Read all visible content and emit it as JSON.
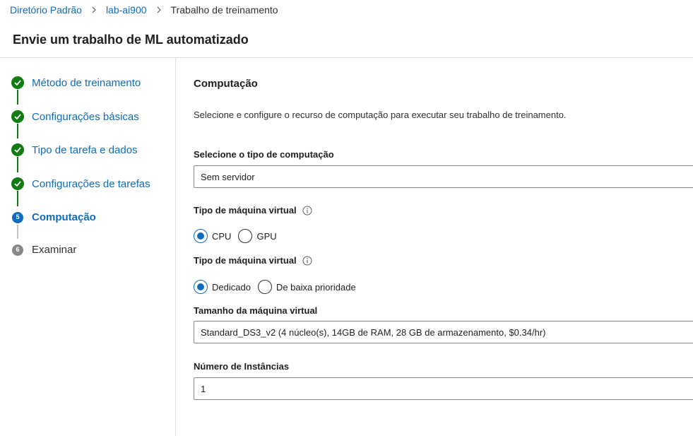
{
  "breadcrumb": {
    "items": [
      "Diretório Padrão",
      "lab-ai900"
    ],
    "current": "Trabalho de treinamento"
  },
  "page_title": "Envie um trabalho de ML automatizado",
  "steps": [
    {
      "label": "Método de treinamento",
      "status": "done"
    },
    {
      "label": "Configurações básicas",
      "status": "done"
    },
    {
      "label": "Tipo de tarefa e dados",
      "status": "done"
    },
    {
      "label": "Configurações de tarefas",
      "status": "done"
    },
    {
      "label": "Computação",
      "status": "current",
      "number": "5"
    },
    {
      "label": "Examinar",
      "status": "pending",
      "number": "6"
    }
  ],
  "main": {
    "section_title": "Computação",
    "description": "Selecione e configure o recurso de computação para executar seu trabalho de treinamento.",
    "compute_type": {
      "label": "Selecione o tipo de computação",
      "value": "Sem servidor"
    },
    "vm_type": {
      "label": "Tipo de máquina virtual",
      "options": [
        "CPU",
        "GPU"
      ],
      "selected": "CPU"
    },
    "vm_tier": {
      "label": "Tipo de máquina virtual",
      "options": [
        "Dedicado",
        "De baixa prioridade"
      ],
      "selected": "Dedicado"
    },
    "vm_size": {
      "label": "Tamanho da máquina virtual",
      "value": "Standard_DS3_v2 (4 núcleo(s), 14GB de RAM, 28 GB de armazenamento, $0.34/hr)"
    },
    "instances": {
      "label": "Número de Instâncias",
      "value": "1"
    }
  },
  "colors": {
    "accent": "#0f6cbd",
    "done": "#107c10",
    "pending": "#8a8886",
    "border": "#8a8886",
    "divider": "#e1dfdd"
  },
  "icons": {
    "done_step": "checkmark-circle-icon",
    "breadcrumb_separator": "chevron-right-icon",
    "info": "info-icon"
  }
}
